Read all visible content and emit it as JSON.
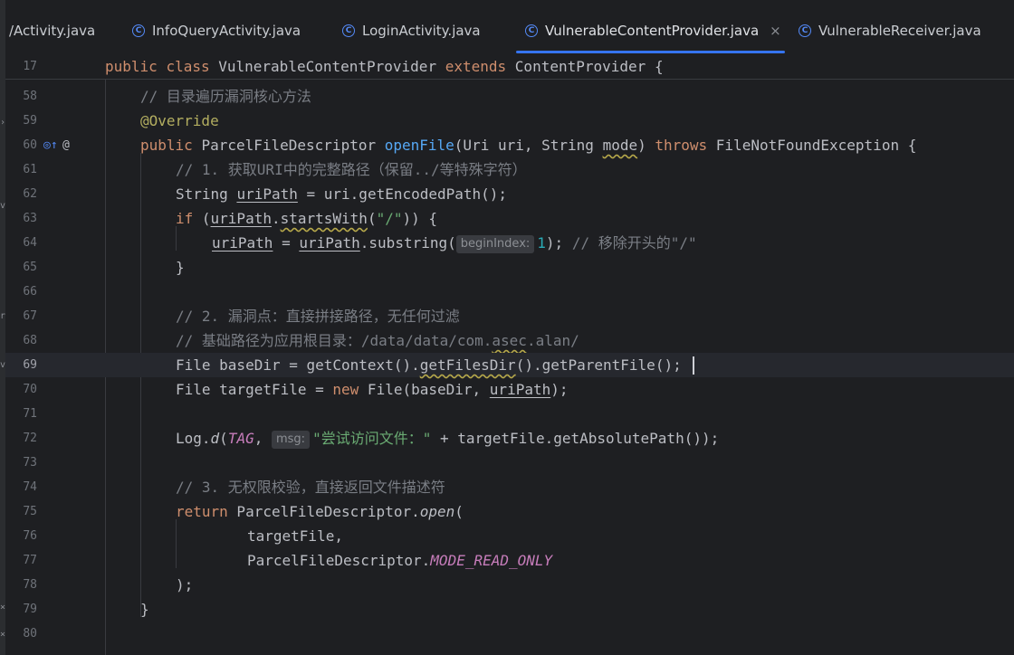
{
  "tabs": [
    {
      "label": "/Activity.java",
      "active": false,
      "icon": "class-icon"
    },
    {
      "label": "InfoQueryActivity.java",
      "active": false,
      "icon": "class-icon"
    },
    {
      "label": "LoginActivity.java",
      "active": false,
      "icon": "class-icon"
    },
    {
      "label": "VulnerableContentProvider.java",
      "active": true,
      "icon": "class-icon"
    },
    {
      "label": "VulnerableReceiver.java",
      "active": false,
      "icon": "class-icon"
    }
  ],
  "sticky": {
    "line_number": "17",
    "kw1": "public",
    "kw2": "class",
    "name": "VulnerableContentProvider",
    "kw3": "extends",
    "parent": "ContentProvider",
    "brace": "{"
  },
  "lines": {
    "l58": {
      "n": "58",
      "comment": "// 目录遍历漏洞核心方法"
    },
    "l59": {
      "n": "59",
      "annotation": "@Override"
    },
    "l60": {
      "n": "60",
      "kw": "public",
      "type": "ParcelFileDescriptor",
      "method": "openFile",
      "p1": "(Uri uri, String ",
      "mode": "mode",
      "p2": ") ",
      "throws": "throws",
      "exc": " FileNotFoundException {"
    },
    "l61": {
      "n": "61",
      "comment": "// 1. 获取URI中的完整路径（保留../等特殊字符）"
    },
    "l62": {
      "n": "62",
      "t1": "String ",
      "var": "uriPath",
      "t2": " = uri.getEncodedPath();"
    },
    "l63": {
      "n": "63",
      "kw": "if",
      "t1": " (",
      "var": "uriPath",
      "t2": ".",
      "m": "startsWith",
      "t3": "(",
      "s": "\"/\"",
      "t4": ")) {"
    },
    "l64": {
      "n": "64",
      "var": "uriPath",
      "t1": " = ",
      "var2": "uriPath",
      "t2": ".substring(",
      "hint": "beginIndex:",
      "num": "1",
      "t3": "); ",
      "comment": "// 移除开头的\"/\""
    },
    "l65": {
      "n": "65",
      "t1": "}"
    },
    "l66": {
      "n": "66"
    },
    "l67": {
      "n": "67",
      "comment": "// 2. 漏洞点：直接拼接路径，无任何过滤"
    },
    "l68": {
      "n": "68",
      "c1": "// 基础路径为应用根目录：/data/data/com.",
      "c2": "asec",
      "c3": ".alan/"
    },
    "l69": {
      "n": "69",
      "t1": "File baseDir = getContext().",
      "m": "getFilesDir",
      "t2": "().getParentFile();"
    },
    "l70": {
      "n": "70",
      "t1": "File targetFile = ",
      "kw": "new",
      "t2": " File(baseDir, ",
      "var": "uriPath",
      "t3": ");"
    },
    "l71": {
      "n": "71"
    },
    "l72": {
      "n": "72",
      "t1": "Log.",
      "m": "d",
      "t2": "(",
      "tag": "TAG",
      "t3": ", ",
      "hint": "msg:",
      "s": "\"尝试访问文件：\"",
      "t4": " + targetFile.getAbsolutePath());"
    },
    "l73": {
      "n": "73"
    },
    "l74": {
      "n": "74",
      "comment": "// 3. 无权限校验，直接返回文件描述符"
    },
    "l75": {
      "n": "75",
      "kw": "return",
      "t1": " ParcelFileDescriptor.",
      "m": "open",
      "t2": "("
    },
    "l76": {
      "n": "76",
      "t1": "targetFile,"
    },
    "l77": {
      "n": "77",
      "t1": "ParcelFileDescriptor.",
      "c": "MODE_READ_ONLY"
    },
    "l78": {
      "n": "78",
      "t1": ");"
    },
    "l79": {
      "n": "79",
      "t1": "}"
    },
    "l80": {
      "n": "80"
    }
  },
  "gutter": {
    "override_icon": "override-method-icon",
    "at_icon": "annotation-icon"
  },
  "colors": {
    "accent": "#3574f0",
    "keyword": "#cf8e6d",
    "method": "#56a8f5",
    "string": "#6aab73",
    "comment": "#7a7e85"
  }
}
